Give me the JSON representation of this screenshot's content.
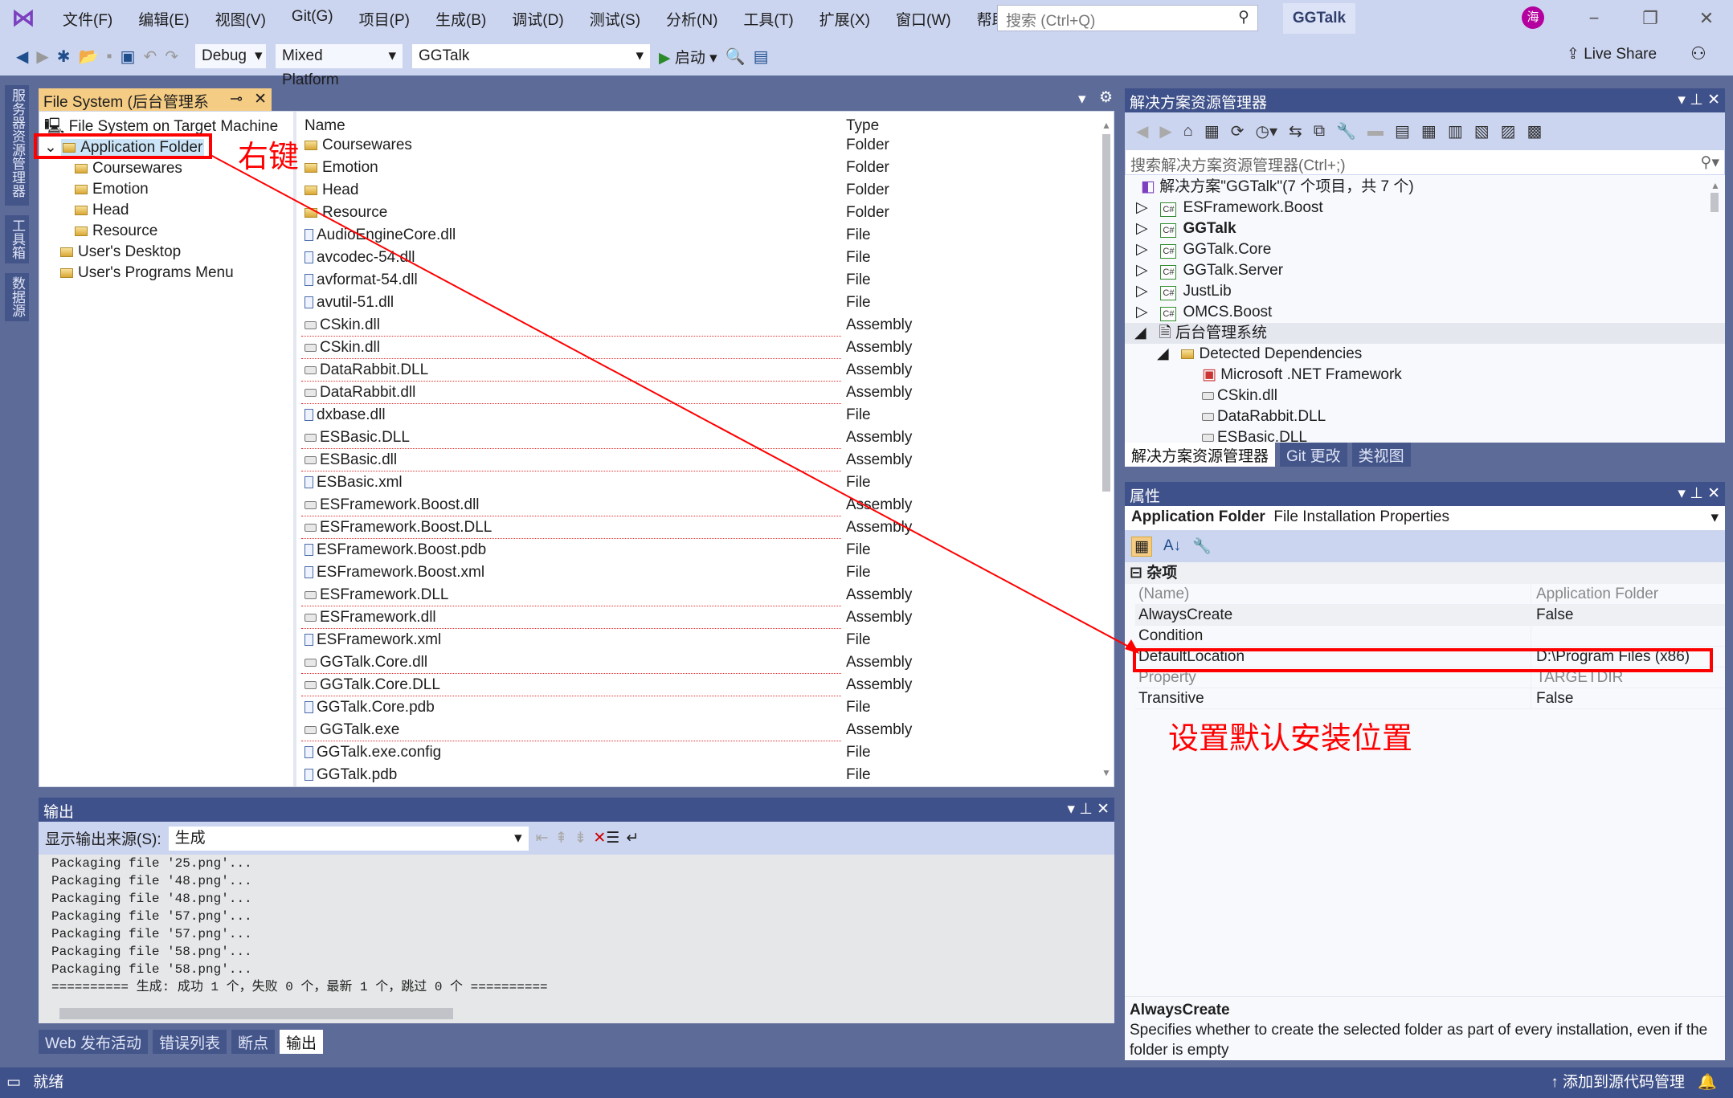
{
  "menubar": {
    "items": [
      "文件(F)",
      "编辑(E)",
      "视图(V)",
      "Git(G)",
      "项目(P)",
      "生成(B)",
      "调试(D)",
      "测试(S)",
      "分析(N)",
      "工具(T)",
      "扩展(X)",
      "窗口(W)",
      "帮助(H)"
    ],
    "search_placeholder": "搜索 (Ctrl+Q)",
    "app_title": "GGTalk",
    "avatar": "海"
  },
  "toolbar": {
    "config": "Debug",
    "platform": "Mixed Platform",
    "startup": "GGTalk",
    "start_label": "启动",
    "live_share": "Live Share"
  },
  "side_tabs": [
    "服务器资源管理器",
    "工具箱",
    "数据源"
  ],
  "doc_tab": {
    "title": "File System (后台管理系统)"
  },
  "fs_tree": {
    "root": "File System on Target Machine",
    "app_folder": "Application Folder",
    "children": [
      "Coursewares",
      "Emotion",
      "Head",
      "Resource"
    ],
    "others": [
      "User's Desktop",
      "User's Programs Menu"
    ]
  },
  "file_list": {
    "columns": [
      "Name",
      "Type"
    ],
    "rows": [
      [
        "Coursewares",
        "Folder"
      ],
      [
        "Emotion",
        "Folder"
      ],
      [
        "Head",
        "Folder"
      ],
      [
        "Resource",
        "Folder"
      ],
      [
        "AudioEngineCore.dll",
        "File"
      ],
      [
        "avcodec-54.dll",
        "File"
      ],
      [
        "avformat-54.dll",
        "File"
      ],
      [
        "avutil-51.dll",
        "File"
      ],
      [
        "CSkin.dll",
        "Assembly"
      ],
      [
        "CSkin.dll",
        "Assembly"
      ],
      [
        "DataRabbit.DLL",
        "Assembly"
      ],
      [
        "DataRabbit.dll",
        "Assembly"
      ],
      [
        "dxbase.dll",
        "File"
      ],
      [
        "ESBasic.DLL",
        "Assembly"
      ],
      [
        "ESBasic.dll",
        "Assembly"
      ],
      [
        "ESBasic.xml",
        "File"
      ],
      [
        "ESFramework.Boost.dll",
        "Assembly"
      ],
      [
        "ESFramework.Boost.DLL",
        "Assembly"
      ],
      [
        "ESFramework.Boost.pdb",
        "File"
      ],
      [
        "ESFramework.Boost.xml",
        "File"
      ],
      [
        "ESFramework.DLL",
        "Assembly"
      ],
      [
        "ESFramework.dll",
        "Assembly"
      ],
      [
        "ESFramework.xml",
        "File"
      ],
      [
        "GGTalk.Core.dll",
        "Assembly"
      ],
      [
        "GGTalk.Core.DLL",
        "Assembly"
      ],
      [
        "GGTalk.Core.pdb",
        "File"
      ],
      [
        "GGTalk.exe",
        "Assembly"
      ],
      [
        "GGTalk.exe.config",
        "File"
      ],
      [
        "GGTalk.pdb",
        "File"
      ]
    ]
  },
  "annotations": {
    "right_click": "右键",
    "set_default": "设置默认安装位置",
    "color": "#ff0000"
  },
  "solution": {
    "title": "解决方案资源管理器",
    "search_placeholder": "搜索解决方案资源管理器(Ctrl+;)",
    "root": "解决方案\"GGTalk\"(7 个项目，共 7 个)",
    "projects": [
      "ESFramework.Boost",
      "GGTalk",
      "GGTalk.Core",
      "GGTalk.Server",
      "JustLib",
      "OMCS.Boost"
    ],
    "setup_project": "后台管理系统",
    "deps_folder": "Detected Dependencies",
    "deps": [
      "Microsoft .NET Framework",
      "CSkin.dll",
      "DataRabbit.DLL",
      "ESBasic.DLL"
    ],
    "tabs": [
      "解决方案资源管理器",
      "Git 更改",
      "类视图"
    ]
  },
  "properties": {
    "title": "属性",
    "object": "Application Folder",
    "object_type": "File Installation Properties",
    "category": "杂项",
    "rows": [
      [
        "(Name)",
        "Application Folder"
      ],
      [
        "AlwaysCreate",
        "False"
      ],
      [
        "Condition",
        ""
      ],
      [
        "DefaultLocation",
        "D:\\Program Files (x86)"
      ],
      [
        "Property",
        "TARGETDIR"
      ],
      [
        "Transitive",
        "False"
      ]
    ],
    "desc_title": "AlwaysCreate",
    "desc_text": "Specifies whether to create the selected folder as part of every installation, even if the folder is empty"
  },
  "output": {
    "title": "输出",
    "source_label": "显示输出来源(S):",
    "source_value": "生成",
    "lines": [
      "Packaging file '25.png'...",
      "Packaging file '48.png'...",
      "Packaging file '48.png'...",
      "Packaging file '57.png'...",
      "Packaging file '57.png'...",
      "Packaging file '58.png'...",
      "Packaging file '58.png'...",
      "========== 生成: 成功 1 个，失败 0 个，最新 1 个，跳过 0 个 =========="
    ],
    "tabs": [
      "Web 发布活动",
      "错误列表",
      "断点",
      "输出"
    ]
  },
  "status": {
    "text": "就绪",
    "source_control": "添加到源代码管理"
  }
}
